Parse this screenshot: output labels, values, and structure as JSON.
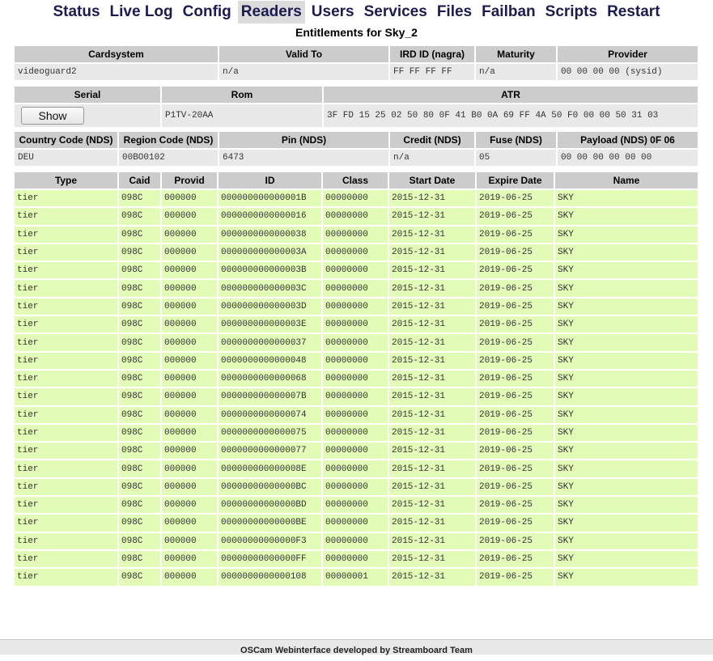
{
  "nav": [
    {
      "label": "Status",
      "active": false
    },
    {
      "label": "Live Log",
      "active": false
    },
    {
      "label": "Config",
      "active": false
    },
    {
      "label": "Readers",
      "active": true
    },
    {
      "label": "Users",
      "active": false
    },
    {
      "label": "Services",
      "active": false
    },
    {
      "label": "Files",
      "active": false
    },
    {
      "label": "Failban",
      "active": false
    },
    {
      "label": "Scripts",
      "active": false
    },
    {
      "label": "Restart",
      "active": false
    }
  ],
  "title": "Entitlements for Sky_2",
  "info": {
    "headers1": [
      "Cardsystem",
      "Valid To",
      "IRD ID (nagra)",
      "Maturity",
      "Provider"
    ],
    "values1": [
      "videoguard2",
      "n/a",
      "FF FF FF FF",
      "n/a",
      "00 00 00 00 (sysid)"
    ],
    "headers2": [
      "Serial",
      "Rom",
      "ATR"
    ],
    "show_button": "Show",
    "rom": "P1TV-20AA",
    "atr": "3F FD 15 25 02 50 80 0F 41 B0 0A 69 FF 4A 50 F0 00 00 50 31 03",
    "headers3": [
      "Country Code (NDS)",
      "Region Code (NDS)",
      "Pin (NDS)",
      "Credit (NDS)",
      "Fuse (NDS)",
      "Payload (NDS) 0F 06"
    ],
    "values3": [
      "DEU",
      "00BO0102",
      "6473",
      "n/a",
      "05",
      "00 00 00 00 00 00"
    ]
  },
  "entitlements": {
    "headers": [
      "Type",
      "Caid",
      "Provid",
      "ID",
      "Class",
      "Start Date",
      "Expire Date",
      "Name"
    ],
    "rows": [
      [
        "tier",
        "098C",
        "000000",
        "000000000000001B",
        "00000000",
        "2015-12-31",
        "2019-06-25",
        "SKY"
      ],
      [
        "tier",
        "098C",
        "000000",
        "0000000000000016",
        "00000000",
        "2015-12-31",
        "2019-06-25",
        "SKY"
      ],
      [
        "tier",
        "098C",
        "000000",
        "0000000000000038",
        "00000000",
        "2015-12-31",
        "2019-06-25",
        "SKY"
      ],
      [
        "tier",
        "098C",
        "000000",
        "000000000000003A",
        "00000000",
        "2015-12-31",
        "2019-06-25",
        "SKY"
      ],
      [
        "tier",
        "098C",
        "000000",
        "000000000000003B",
        "00000000",
        "2015-12-31",
        "2019-06-25",
        "SKY"
      ],
      [
        "tier",
        "098C",
        "000000",
        "000000000000003C",
        "00000000",
        "2015-12-31",
        "2019-06-25",
        "SKY"
      ],
      [
        "tier",
        "098C",
        "000000",
        "000000000000003D",
        "00000000",
        "2015-12-31",
        "2019-06-25",
        "SKY"
      ],
      [
        "tier",
        "098C",
        "000000",
        "000000000000003E",
        "00000000",
        "2015-12-31",
        "2019-06-25",
        "SKY"
      ],
      [
        "tier",
        "098C",
        "000000",
        "0000000000000037",
        "00000000",
        "2015-12-31",
        "2019-06-25",
        "SKY"
      ],
      [
        "tier",
        "098C",
        "000000",
        "0000000000000048",
        "00000000",
        "2015-12-31",
        "2019-06-25",
        "SKY"
      ],
      [
        "tier",
        "098C",
        "000000",
        "0000000000000068",
        "00000000",
        "2015-12-31",
        "2019-06-25",
        "SKY"
      ],
      [
        "tier",
        "098C",
        "000000",
        "000000000000007B",
        "00000000",
        "2015-12-31",
        "2019-06-25",
        "SKY"
      ],
      [
        "tier",
        "098C",
        "000000",
        "0000000000000074",
        "00000000",
        "2015-12-31",
        "2019-06-25",
        "SKY"
      ],
      [
        "tier",
        "098C",
        "000000",
        "0000000000000075",
        "00000000",
        "2015-12-31",
        "2019-06-25",
        "SKY"
      ],
      [
        "tier",
        "098C",
        "000000",
        "0000000000000077",
        "00000000",
        "2015-12-31",
        "2019-06-25",
        "SKY"
      ],
      [
        "tier",
        "098C",
        "000000",
        "000000000000008E",
        "00000000",
        "2015-12-31",
        "2019-06-25",
        "SKY"
      ],
      [
        "tier",
        "098C",
        "000000",
        "00000000000000BC",
        "00000000",
        "2015-12-31",
        "2019-06-25",
        "SKY"
      ],
      [
        "tier",
        "098C",
        "000000",
        "00000000000000BD",
        "00000000",
        "2015-12-31",
        "2019-06-25",
        "SKY"
      ],
      [
        "tier",
        "098C",
        "000000",
        "00000000000000BE",
        "00000000",
        "2015-12-31",
        "2019-06-25",
        "SKY"
      ],
      [
        "tier",
        "098C",
        "000000",
        "00000000000000F3",
        "00000000",
        "2015-12-31",
        "2019-06-25",
        "SKY"
      ],
      [
        "tier",
        "098C",
        "000000",
        "00000000000000FF",
        "00000000",
        "2015-12-31",
        "2019-06-25",
        "SKY"
      ],
      [
        "tier",
        "098C",
        "000000",
        "0000000000000108",
        "00000001",
        "2015-12-31",
        "2019-06-25",
        "SKY"
      ]
    ]
  },
  "footer": "OSCam Webinterface developed by Streamboard Team",
  "colors": {
    "nav_text": "#1b1b4f",
    "header_bg": "#cccccc",
    "value_bg": "#e8e8e8",
    "entitlement_bg": "#e2fbb6"
  }
}
